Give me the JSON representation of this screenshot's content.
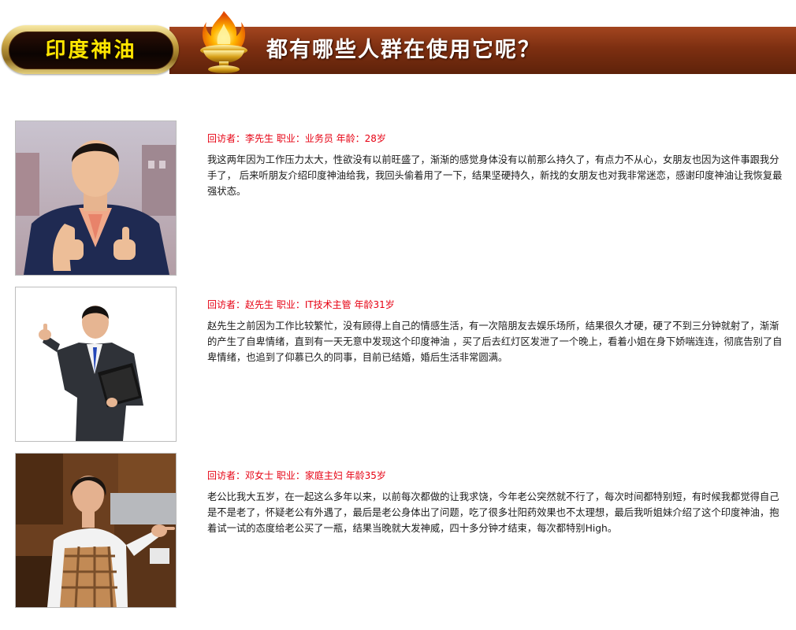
{
  "header": {
    "product_badge": "印度神油",
    "headline": "都有哪些人群在使用它呢？",
    "colors": {
      "banner": "#7d2f11",
      "badge_text": "#ffe600",
      "meta_text": "#e60012"
    },
    "icons": [
      "trophy-flame-icon"
    ]
  },
  "testimonials": [
    {
      "meta": "回访者：李先生  职业：业务员   年龄：28岁",
      "text": "我这两年因为工作压力太大，性欲没有以前旺盛了，渐渐的感觉身体没有以前那么持久了，有点力不从心，女朋友也因为这件事跟我分手了，  后来听朋友介绍印度神油给我，我回头偷着用了一下，结果坚硬持久，新找的女朋友也对我非常迷恋，感谢印度神油让我恢复最强状态。",
      "photo": "businessman-thumbs-up-photo"
    },
    {
      "meta": "回访者：赵先生  职业：IT技术主管   年龄31岁",
      "text": "赵先生之前因为工作比较繁忙，没有顾得上自己的情感生活，有一次陪朋友去娱乐场所，结果很久才硬，硬了不到三分钟就射了，渐渐的产生了自卑情绪，直到有一天无意中发现这个印度神油 ，买了后去红灯区发泄了一个晚上，看着小姐在身下娇喘连连，彻底告别了自卑情绪，也追到了仰慕已久的同事，目前已结婚，婚后生活非常圆满。",
      "photo": "man-with-folder-thumbs-up-photo"
    },
    {
      "meta": "回访者：邓女士  职业：家庭主妇   年龄35岁",
      "text": "老公比我大五岁，在一起这么多年以来，以前每次都做的让我求饶，今年老公突然就不行了，每次时间都特别短，有时候我都觉得自己是不是老了，怀疑老公有外遇了，最后是老公身体出了问题，吃了很多壮阳药效果也不太理想，最后我听姐妹介绍了这个印度神油，抱着试一试的态度给老公买了一瓶，结果当晚就大发神威，四十多分钟才结束，每次都特别High。",
      "photo": "woman-in-kitchen-photo"
    }
  ]
}
